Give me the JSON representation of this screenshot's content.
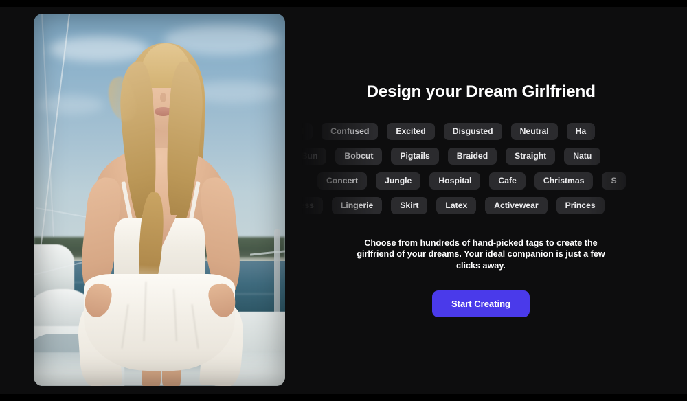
{
  "hero": {
    "title": "Design your Dream Girlfriend",
    "description": "Choose from hundreds of hand-picked tags to create the girlfriend of your dreams. Your ideal companion is just a few clicks away.",
    "cta_label": "Start Creating",
    "accent_color": "#4A3AEA",
    "background_color": "#0d0d0e",
    "tag_background_color": "#2b2b2e"
  },
  "photo": {
    "alt": "Blonde woman in a white slip dress standing on a sailboat deck by the water",
    "subject": "blonde-woman",
    "setting": "sailboat-on-water",
    "dress_color": "#f6f2ea",
    "water_color": "#2d5665",
    "sky_color": "#93b6cd"
  },
  "tag_rows": [
    {
      "id": "emotion",
      "tags": [
        "rised",
        "Confused",
        "Excited",
        "Disgusted",
        "Neutral",
        "Ha"
      ]
    },
    {
      "id": "hairstyle",
      "tags": [
        "ssy Bun",
        "Bobcut",
        "Pigtails",
        "Braided",
        "Straight",
        "Natu"
      ]
    },
    {
      "id": "scene",
      "tags": [
        "Concert",
        "Jungle",
        "Hospital",
        "Cafe",
        "Christmas",
        "S"
      ]
    },
    {
      "id": "outfit",
      "tags": [
        "Dress",
        "Lingerie",
        "Skirt",
        "Latex",
        "Activewear",
        "Princes"
      ]
    }
  ]
}
